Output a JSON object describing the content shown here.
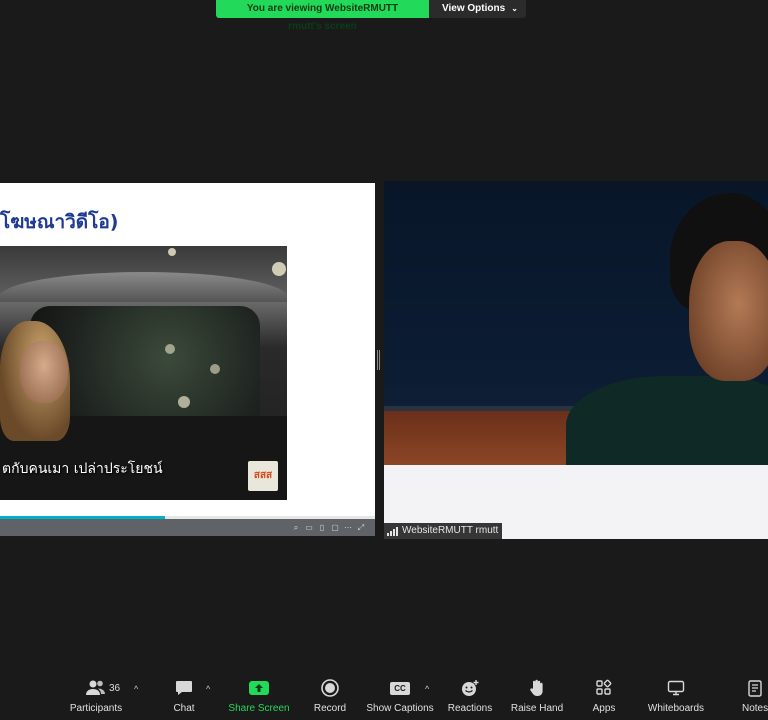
{
  "banner": {
    "message": "You are viewing WebsiteRMUTT rmutt's screen",
    "options_label": "View Options",
    "options_chevron": "⌄",
    "accent": "#23d959"
  },
  "shared_screen": {
    "slide_title": "โฆษณาวิดีโอ)",
    "video_subtitle": "ตกับคนเมา เปล่าประโยชน์",
    "logo_text": "สสส",
    "progress": 0.44
  },
  "participant": {
    "name": "WebsiteRMUTT rmutt"
  },
  "toolbar": {
    "participants_label": "Participants",
    "participants_count": "36",
    "chat_label": "Chat",
    "share_label": "Share Screen",
    "record_label": "Record",
    "captions_label": "Show Captions",
    "captions_icon_text": "CC",
    "reactions_label": "Reactions",
    "raise_hand_label": "Raise Hand",
    "apps_label": "Apps",
    "whiteboards_label": "Whiteboards",
    "notes_label": "Notes",
    "caret": "^"
  }
}
